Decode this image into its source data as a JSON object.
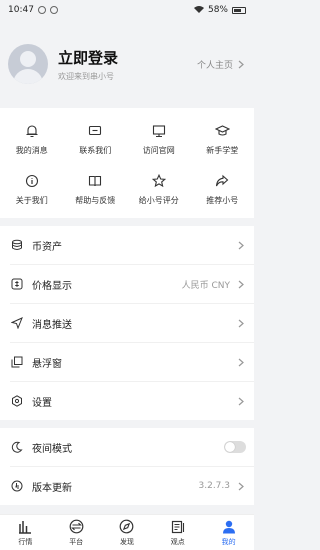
{
  "status_bar": {
    "time": "10:47",
    "battery": "58%"
  },
  "profile": {
    "title": "立即登录",
    "subtitle": "欢迎来到串小号",
    "homepage": "个人主页"
  },
  "grid": [
    {
      "label": "我的消息",
      "icon": "bell-icon"
    },
    {
      "label": "联系我们",
      "icon": "message-icon"
    },
    {
      "label": "访问官网",
      "icon": "monitor-icon"
    },
    {
      "label": "新手学堂",
      "icon": "graduation-cap-icon"
    },
    {
      "label": "关于我们",
      "icon": "info-icon"
    },
    {
      "label": "帮助与反馈",
      "icon": "book-icon"
    },
    {
      "label": "给小号评分",
      "icon": "star-icon"
    },
    {
      "label": "推荐小号",
      "icon": "share-icon"
    }
  ],
  "list": [
    {
      "label": "币资产",
      "value": "",
      "icon": "coins-icon"
    },
    {
      "label": "价格显示",
      "value": "人民币 CNY",
      "icon": "price-icon"
    },
    {
      "label": "消息推送",
      "value": "",
      "icon": "send-icon"
    },
    {
      "label": "悬浮窗",
      "value": "",
      "icon": "window-icon"
    },
    {
      "label": "设置",
      "value": "",
      "icon": "settings-icon"
    }
  ],
  "night_mode": {
    "label": "夜间模式"
  },
  "version": {
    "label": "版本更新",
    "value": "3.2.7.3"
  },
  "nav": [
    {
      "label": "行情",
      "icon": "bars-icon"
    },
    {
      "label": "平台",
      "icon": "platform-icon"
    },
    {
      "label": "发现",
      "icon": "compass-icon"
    },
    {
      "label": "观点",
      "icon": "article-icon"
    },
    {
      "label": "我的",
      "icon": "user-icon"
    }
  ],
  "colors": {
    "accent": "#2c6ef2",
    "background": "#f2f3f5"
  }
}
